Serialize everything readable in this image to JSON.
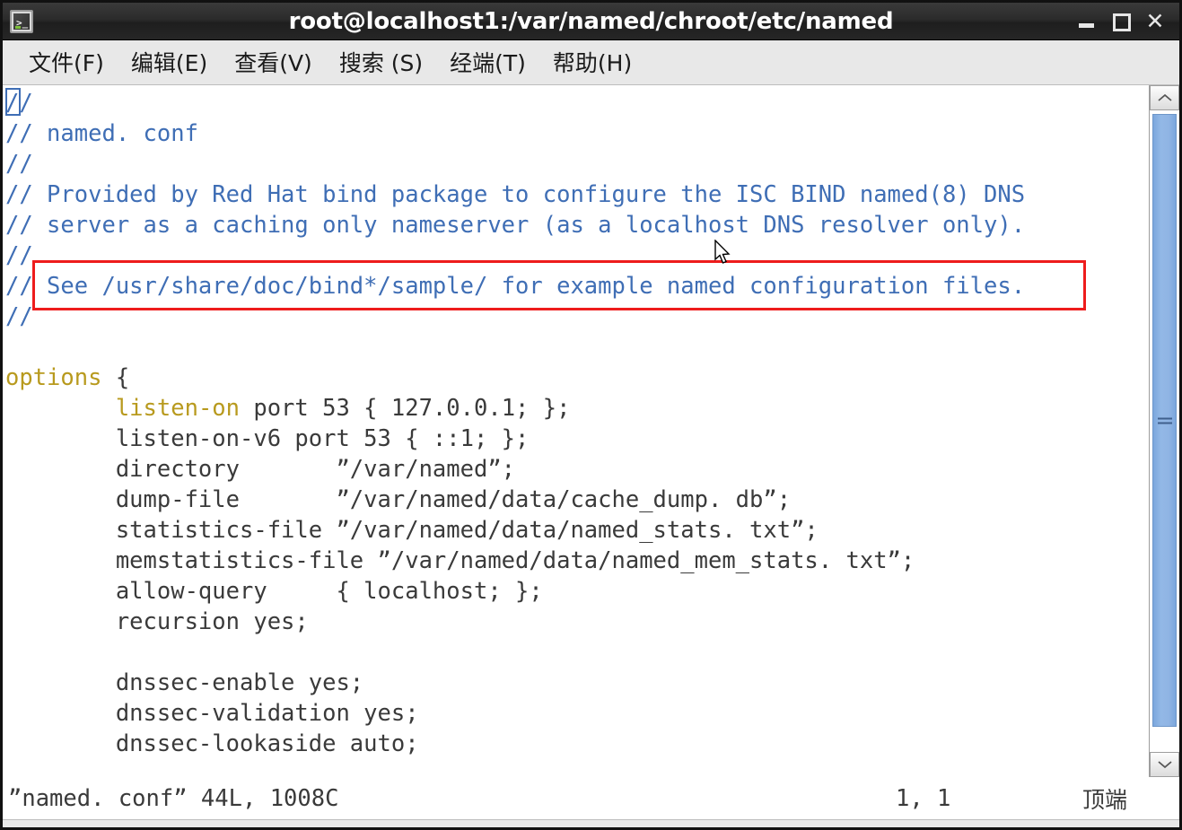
{
  "window": {
    "title": "root@localhost1:/var/named/chroot/etc/named",
    "icon": "terminal-icon",
    "icon_prompt": ">_",
    "controls": {
      "minimize": "–",
      "maximize": "□",
      "close": "✕"
    }
  },
  "menubar": {
    "items": [
      {
        "label": "文件(F)"
      },
      {
        "label": "编辑(E)"
      },
      {
        "label": "查看(V)"
      },
      {
        "label": "搜索 (S)"
      },
      {
        "label": "经端(T)"
      },
      {
        "label": "帮助(H)"
      }
    ]
  },
  "editor": {
    "lines": [
      {
        "segments": [
          {
            "text": "//",
            "style": "cmt"
          }
        ]
      },
      {
        "segments": [
          {
            "text": "// named. conf",
            "style": "cmt"
          }
        ]
      },
      {
        "segments": [
          {
            "text": "//",
            "style": "cmt"
          }
        ]
      },
      {
        "segments": [
          {
            "text": "// Provided by Red Hat bind package to configure the ISC BIND named(8) DNS",
            "style": "cmt"
          }
        ]
      },
      {
        "segments": [
          {
            "text": "// server as a caching only nameserver (as a localhost DNS resolver only).",
            "style": "cmt"
          }
        ]
      },
      {
        "segments": [
          {
            "text": "//",
            "style": "cmt"
          }
        ]
      },
      {
        "segments": [
          {
            "text": "// See /usr/share/doc/bind*/sample/ for example named configuration files.",
            "style": "cmt"
          }
        ]
      },
      {
        "segments": [
          {
            "text": "//",
            "style": "cmt"
          }
        ]
      },
      {
        "segments": [
          {
            "text": "",
            "style": "txt"
          }
        ]
      },
      {
        "segments": [
          {
            "text": "options",
            "style": "kw"
          },
          {
            "text": " {",
            "style": "txt"
          }
        ]
      },
      {
        "segments": [
          {
            "text": "        ",
            "style": "txt"
          },
          {
            "text": "listen-on",
            "style": "kw"
          },
          {
            "text": " port 53 { 127.0.0.1; };",
            "style": "txt"
          }
        ]
      },
      {
        "segments": [
          {
            "text": "        listen-on-v6 port 53 { ::1; };",
            "style": "txt"
          }
        ]
      },
      {
        "segments": [
          {
            "text": "        directory       ”/var/named”;",
            "style": "txt"
          }
        ]
      },
      {
        "segments": [
          {
            "text": "        dump-file       ”/var/named/data/cache_dump. db”;",
            "style": "txt"
          }
        ]
      },
      {
        "segments": [
          {
            "text": "        statistics-file ”/var/named/data/named_stats. txt”;",
            "style": "txt"
          }
        ]
      },
      {
        "segments": [
          {
            "text": "        memstatistics-file ”/var/named/data/named_mem_stats. txt”;",
            "style": "txt"
          }
        ]
      },
      {
        "segments": [
          {
            "text": "        allow-query     { localhost; };",
            "style": "txt"
          }
        ]
      },
      {
        "segments": [
          {
            "text": "        recursion yes;",
            "style": "txt"
          }
        ]
      },
      {
        "segments": [
          {
            "text": "",
            "style": "txt"
          }
        ]
      },
      {
        "segments": [
          {
            "text": "        dnssec-enable yes;",
            "style": "txt"
          }
        ]
      },
      {
        "segments": [
          {
            "text": "        dnssec-validation yes;",
            "style": "txt"
          }
        ]
      },
      {
        "segments": [
          {
            "text": "        dnssec-lookaside auto;",
            "style": "txt"
          }
        ]
      }
    ],
    "annotation": {
      "type": "red-rectangle",
      "color": "#ee1c1c",
      "target_line": "// See /usr/share/doc/bind*/sample/ for example named configuration files."
    },
    "cursor": {
      "line": 1,
      "column": 1
    },
    "colors": {
      "comment": "#3f6eb5",
      "keyword": "#b89a1e",
      "text": "#3a3a3a",
      "background": "#ffffff",
      "highlight": "#ee1c1c",
      "scrollbar_thumb": "#8fb4e4"
    }
  },
  "statusbar": {
    "file_info": "”named. conf” 44L, 1008C",
    "position": "1, 1",
    "scroll_state": "顶端"
  },
  "scrollbar": {
    "up_arrow": "chevron-up-icon",
    "down_arrow": "chevron-down-icon",
    "grip": "grip-lines-icon"
  }
}
